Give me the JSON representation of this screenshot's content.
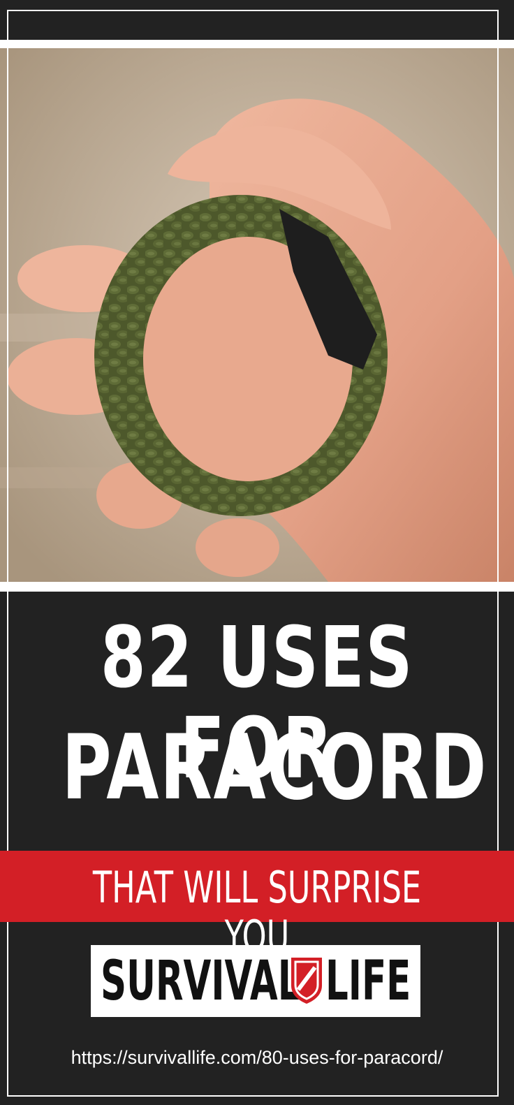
{
  "headline": {
    "line1": "82 USES FOR",
    "line2": "PARACORD"
  },
  "banner": {
    "text": "THAT WILL SURPRISE YOU"
  },
  "logo": {
    "word_left": "SURVIVAL",
    "word_right": "LIFE",
    "icon": "shield-logo-icon"
  },
  "url": "https://survivallife.com/80-uses-for-paracord/",
  "photo": {
    "subject": "hand-holding-paracord-bracelet",
    "icon": "paracord-bracelet-photo"
  },
  "colors": {
    "background": "#222222",
    "accent_red": "#d31f26",
    "text": "#ffffff",
    "paracord_green": "#4e5a2c"
  }
}
